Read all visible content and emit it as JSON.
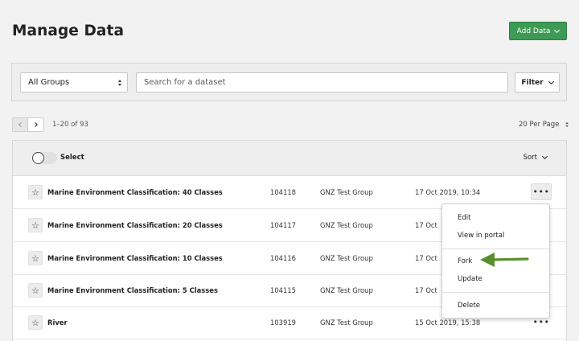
{
  "header": {
    "title": "Manage Data",
    "add_button_label": "Add Data"
  },
  "filters": {
    "group_select_value": "All Groups",
    "search_placeholder": "Search for a dataset",
    "filter_button_label": "Filter"
  },
  "pagination": {
    "range_text": "1–20 of 93",
    "per_page_label": "20 Per Page"
  },
  "table": {
    "select_label": "Select",
    "sort_label": "Sort",
    "rows": [
      {
        "name": "Marine Environment Classification: 40 Classes",
        "id": "104118",
        "group": "GNZ Test Group",
        "date": "17 Oct 2019, 10:34"
      },
      {
        "name": "Marine Environment Classification: 20 Classes",
        "id": "104117",
        "group": "GNZ Test Group",
        "date": "17 Oct"
      },
      {
        "name": "Marine Environment Classification: 10 Classes",
        "id": "104116",
        "group": "GNZ Test Group",
        "date": "17 Oct"
      },
      {
        "name": "Marine Environment Classification: 5 Classes",
        "id": "104115",
        "group": "GNZ Test Group",
        "date": "17 Oct"
      },
      {
        "name": "River",
        "id": "103919",
        "group": "GNZ Test Group",
        "date": "15 Oct 2019, 15:38"
      }
    ]
  },
  "context_menu": {
    "items": [
      "Edit",
      "View in portal",
      "Fork",
      "Update",
      "Delete"
    ]
  },
  "icons": {
    "star": "star-icon",
    "more": "more-horizontal-icon",
    "chevron": "chevron-down-icon",
    "arrow": "annotation-arrow-icon"
  },
  "colors": {
    "primary": "#3d9a55",
    "annotation_arrow": "#5a8f2e"
  }
}
